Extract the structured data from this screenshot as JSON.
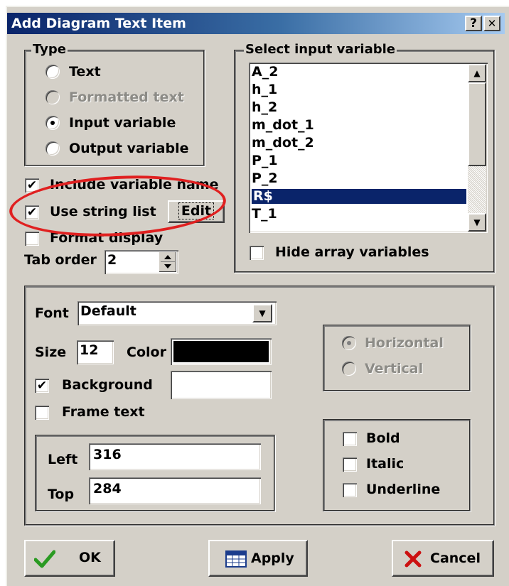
{
  "window": {
    "title": "Add Diagram Text Item",
    "help_label": "?",
    "close_label": "✕"
  },
  "type_group": {
    "legend": "Type",
    "options": [
      {
        "label": "Text",
        "selected": false,
        "enabled": true
      },
      {
        "label": "Formatted text",
        "selected": false,
        "enabled": false
      },
      {
        "label": "Input variable",
        "selected": true,
        "enabled": true
      },
      {
        "label": "Output variable",
        "selected": false,
        "enabled": true
      }
    ]
  },
  "checks": {
    "include_variable_name": {
      "label": "Include variable name",
      "checked": true
    },
    "use_string_list": {
      "label": "Use string list",
      "checked": true
    },
    "format_display": {
      "label": "Format display",
      "checked": false
    }
  },
  "edit_button": {
    "label": "Edit"
  },
  "tab_order": {
    "label": "Tab order",
    "value": "2"
  },
  "input_variable": {
    "legend": "Select input variable",
    "items": [
      "A_2",
      "h_1",
      "h_2",
      "m_dot_1",
      "m_dot_2",
      "P_1",
      "P_2",
      "R$",
      "T_1"
    ],
    "selected": "R$",
    "hide_array": {
      "label": "Hide array variables",
      "checked": false
    }
  },
  "font": {
    "label": "Font",
    "value": "Default"
  },
  "size": {
    "label": "Size",
    "value": "12"
  },
  "color": {
    "label": "Color",
    "value": "#000000"
  },
  "background": {
    "label": "Background",
    "checked": true,
    "color": "#ffffff"
  },
  "frame_text": {
    "label": "Frame text",
    "checked": false
  },
  "orientation": {
    "horizontal": {
      "label": "Horizontal",
      "selected": true,
      "enabled": false
    },
    "vertical": {
      "label": "Vertical",
      "selected": false,
      "enabled": false
    }
  },
  "position": {
    "left_label": "Left",
    "left_value": "316",
    "top_label": "Top",
    "top_value": "284"
  },
  "style": {
    "bold": {
      "label": "Bold",
      "checked": false
    },
    "italic": {
      "label": "Italic",
      "checked": false
    },
    "underline": {
      "label": "Underline",
      "checked": false
    }
  },
  "buttons": {
    "ok": "OK",
    "apply": "Apply",
    "cancel": "Cancel"
  },
  "annotation": {
    "color": "#e02020"
  }
}
